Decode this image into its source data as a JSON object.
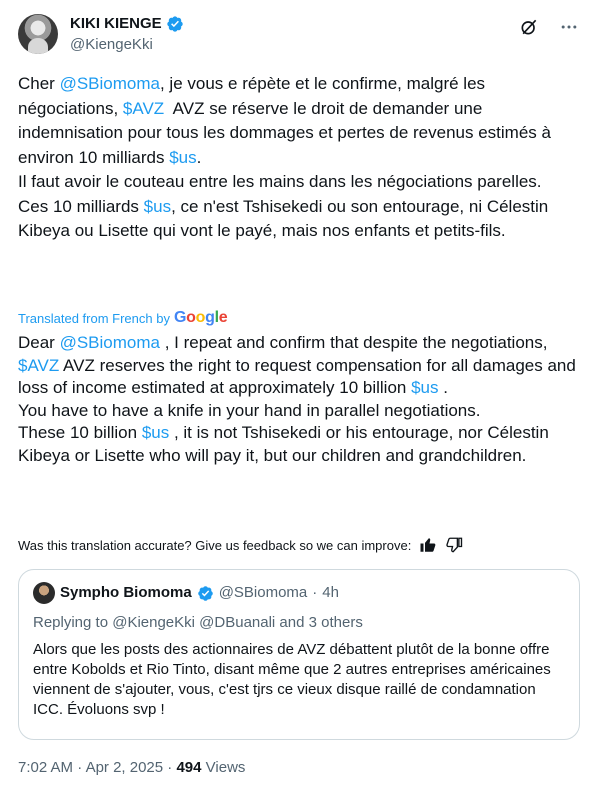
{
  "author": {
    "display_name": "KIKI KIENGE",
    "handle": "@KiengeKki"
  },
  "icons": {
    "verified": "verified-badge-icon",
    "grok": "grok-icon",
    "more": "more-options-icon",
    "like": "thumbs-up-icon",
    "dislike": "thumbs-down-icon"
  },
  "colors": {
    "link": "#1d9bf0",
    "verified": "#1d9bf0",
    "secondary_text": "#536471"
  },
  "original": {
    "p1_a": "Cher ",
    "p1_mention": "@SBiomoma",
    "p1_b": ", je vous e répète et le confirme, malgré les négociations, ",
    "p1_cashtag": "$AVZ",
    "p1_c": "  AVZ se réserve le droit de demander une indemnisation pour tous les dommages et pertes de revenus estimés à environ 10 milliards ",
    "p1_cashtag2": "$us",
    "p1_d": ".",
    "p2": "Il faut avoir le couteau entre les mains dans les négociations parelles.",
    "p3_a": "Ces 10 milliards ",
    "p3_cashtag": "$us",
    "p3_b": ", ce n'est Tshisekedi ou son entourage, ni Célestin Kibeya ou Lisette qui vont le payé, mais nos enfants et petits-fils."
  },
  "translated_label": "Translated from French by",
  "google_logo": "Google",
  "translation": {
    "p1_a": "Dear ",
    "p1_mention": "@SBiomoma",
    "p1_b": " , I repeat and confirm that despite the negotiations, ",
    "p1_cashtag": "$AVZ",
    "p1_c": " AVZ reserves the right to request compensation for all damages and loss of income estimated at approximately 10 billion ",
    "p1_cashtag2": "$us",
    "p1_d": " .",
    "p2": "You have to have a knife in your hand in parallel negotiations.",
    "p3_a": "These 10 billion ",
    "p3_cashtag": "$us",
    "p3_b": " , it is not Tshisekedi or his entourage, nor Célestin Kibeya or Lisette who will pay it, but our children and grandchildren."
  },
  "feedback_text": "Was this translation accurate? Give us feedback so we can improve:",
  "quote": {
    "display_name": "Sympho Biomoma",
    "handle": "@SBiomoma",
    "separator": "·",
    "time": "4h",
    "replying_prefix": "Replying to ",
    "replying_mentions": "@KiengeKki @DBuanali",
    "replying_suffix": " and 3 others",
    "text": "Alors que les posts des actionnaires de AVZ débattent plutôt de la bonne offre entre Kobolds et Rio Tinto, disant même que 2 autres entreprises américaines viennent de s'ajouter, vous, c'est tjrs ce vieux disque raillé de condamnation ICC. Évoluons svp !"
  },
  "meta": {
    "time": "7:02 AM",
    "separator": " · ",
    "date": "Apr 2, 2025",
    "separator2": " · ",
    "views_count": "494",
    "views_label": " Views"
  }
}
